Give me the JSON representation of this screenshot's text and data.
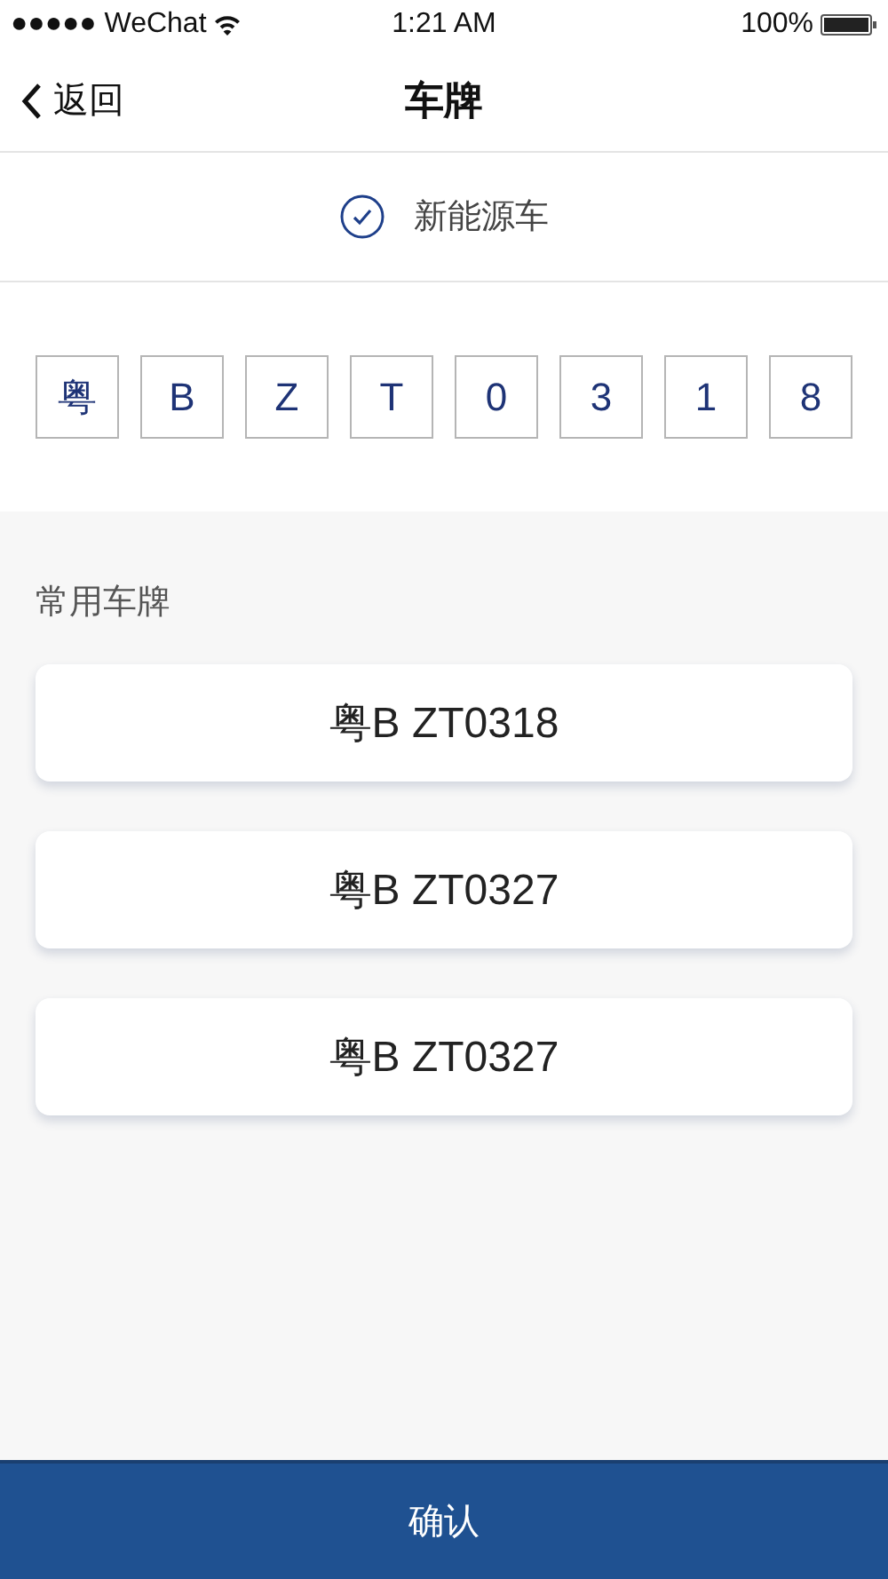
{
  "status_bar": {
    "carrier": "●●●●● WeChat",
    "time": "1:21 AM",
    "battery": "100%"
  },
  "nav": {
    "back": "返回",
    "title": "车牌"
  },
  "new_energy": {
    "label": "新能源车",
    "checked": true
  },
  "plate_chars": [
    "粤",
    "B",
    "Z",
    "T",
    "0",
    "3",
    "1",
    "8"
  ],
  "saved": {
    "heading": "常用车牌",
    "plates": [
      "粤B ZT0318",
      "粤B ZT0327",
      "粤B ZT0327"
    ]
  },
  "confirm": "确认"
}
